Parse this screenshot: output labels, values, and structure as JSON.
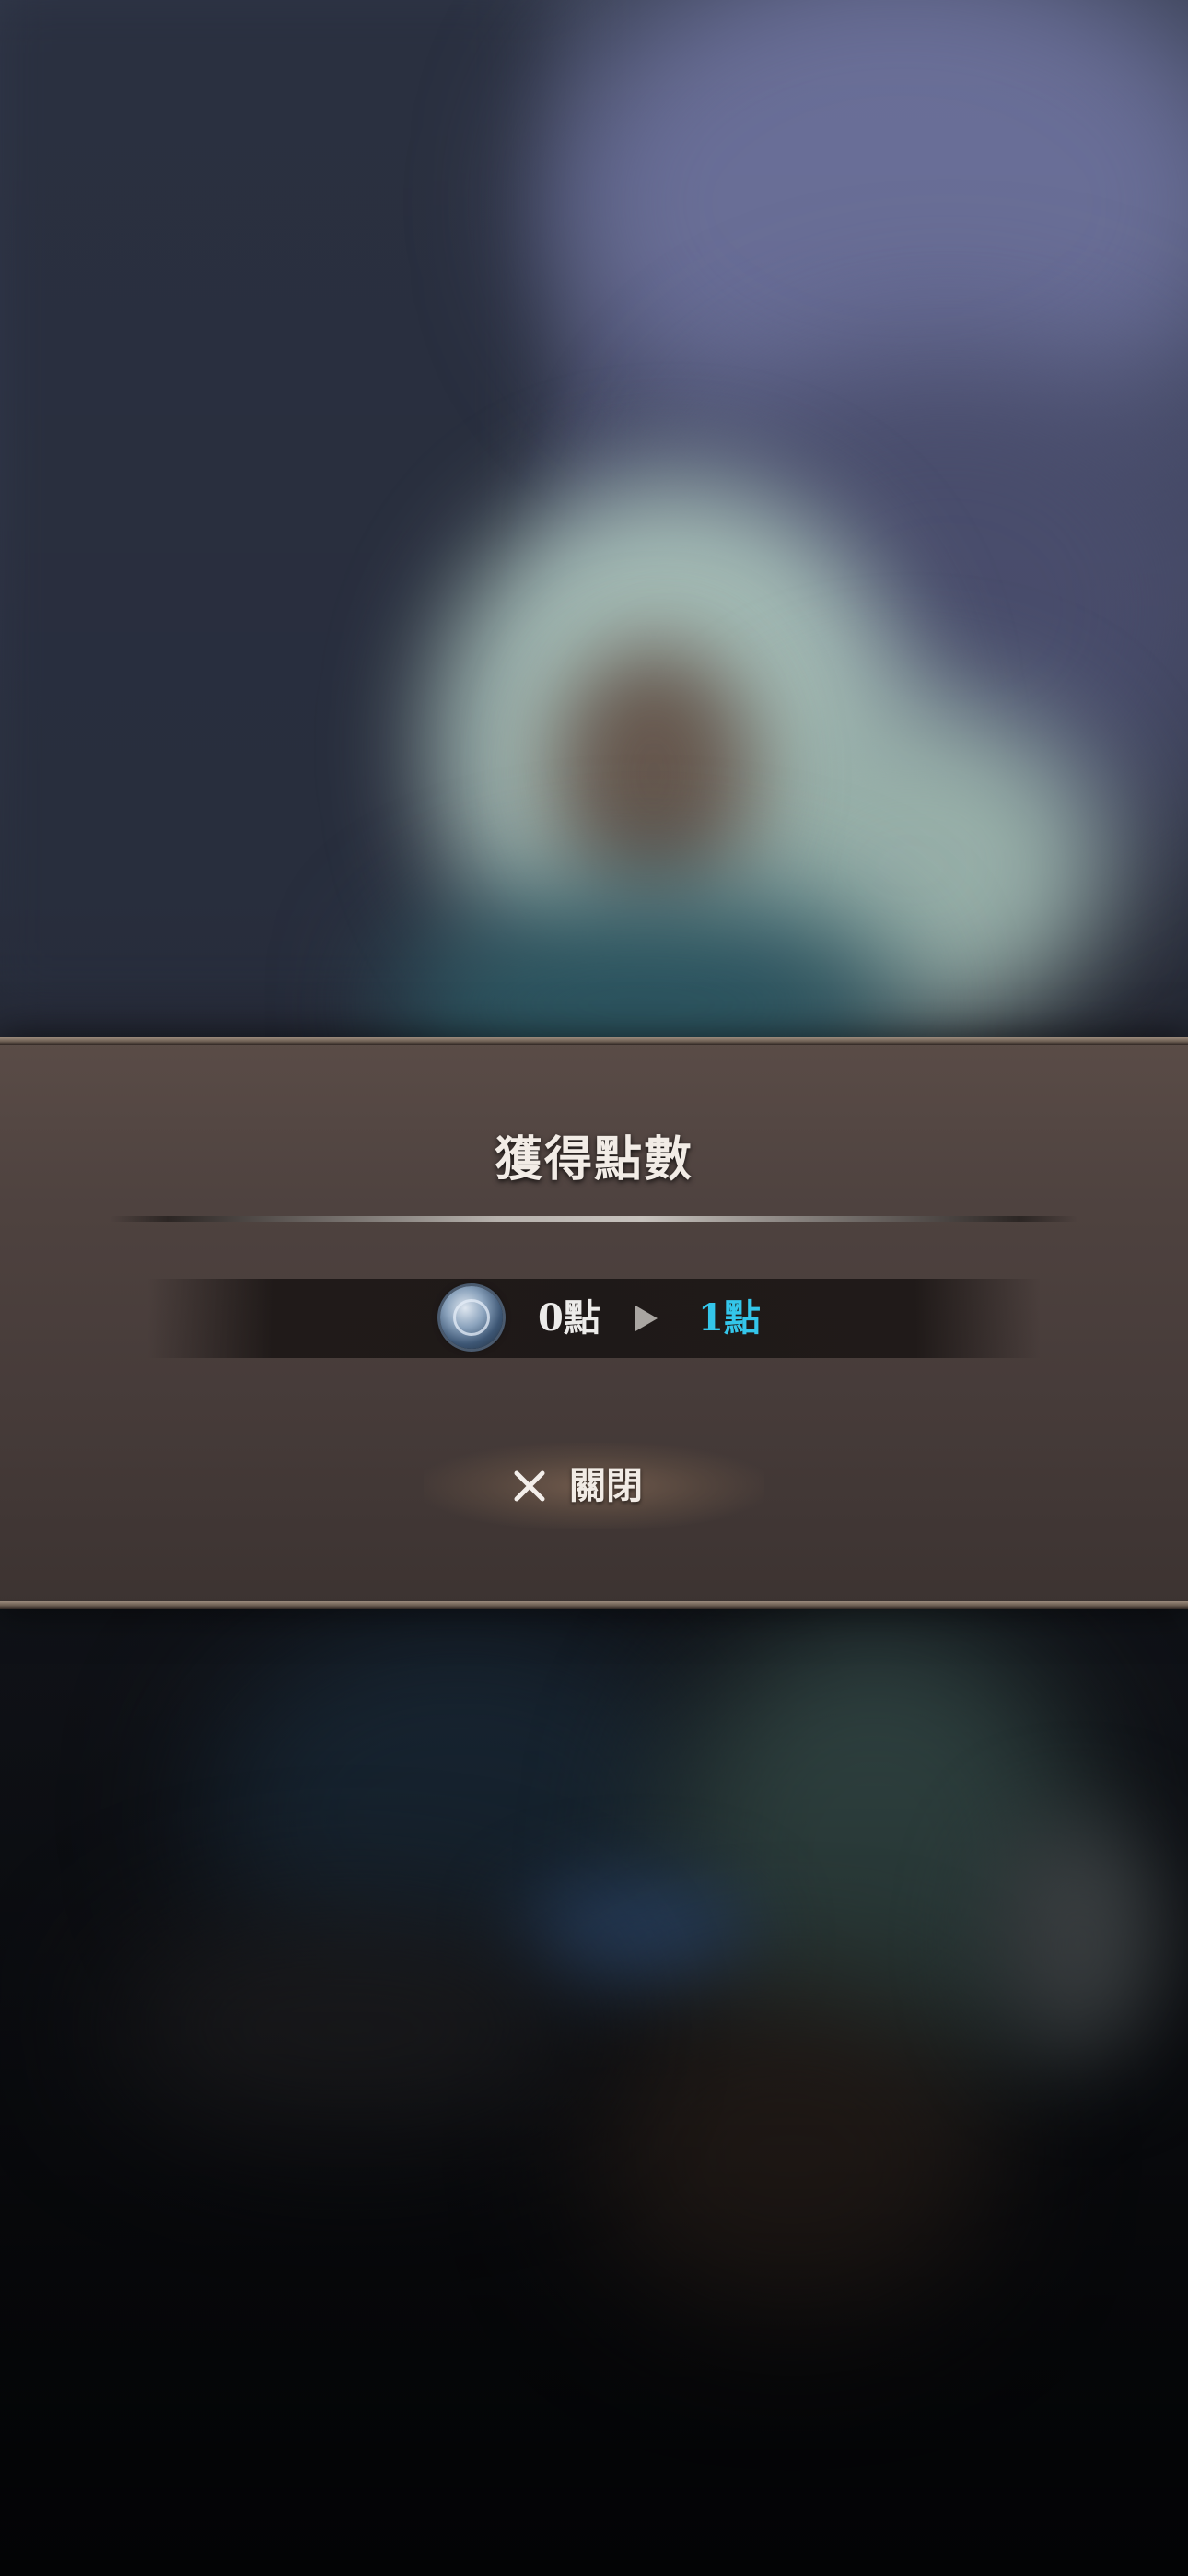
{
  "dialog": {
    "title": "獲得點數",
    "points": {
      "icon": "blue-point-coin-icon",
      "before": "0點",
      "after": "1點",
      "after_color": "#34c6ea"
    },
    "close_button": {
      "icon": "close-x-icon",
      "label": "關閉"
    }
  }
}
